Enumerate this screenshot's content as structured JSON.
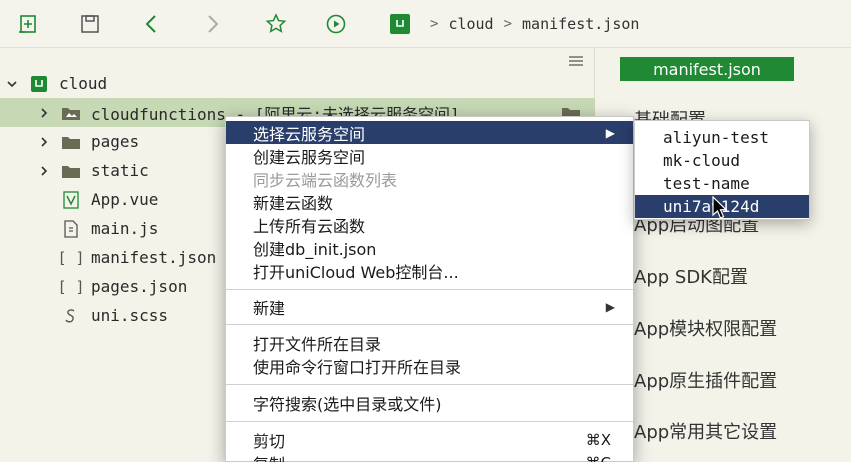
{
  "breadcrumb": {
    "project": "cloud",
    "file": "manifest.json"
  },
  "sidebar": {
    "items": [
      {
        "label": "cloud",
        "type": "project",
        "expanded": true,
        "level": 0
      },
      {
        "label": "cloudfunctions - [阿里云:未选择云服务空间]",
        "type": "folder",
        "level": 1,
        "selected": true
      },
      {
        "label": "pages",
        "type": "folder",
        "level": 1
      },
      {
        "label": "static",
        "type": "folder",
        "level": 1
      },
      {
        "label": "App.vue",
        "type": "vue",
        "level": 1
      },
      {
        "label": "main.js",
        "type": "js",
        "level": 1
      },
      {
        "label": "manifest.json",
        "type": "json",
        "level": 1
      },
      {
        "label": "pages.json",
        "type": "json",
        "level": 1
      },
      {
        "label": "uni.scss",
        "type": "scss",
        "level": 1
      }
    ]
  },
  "right_panel": {
    "tab": "manifest.json",
    "items": [
      "基础配置",
      "App启动图配置",
      "App  SDK配置",
      "App模块权限配置",
      "App原生插件配置",
      "App常用其它设置"
    ]
  },
  "context_menu": {
    "items": [
      {
        "label": "选择云服务空间",
        "submenu": true,
        "active": true
      },
      {
        "label": "创建云服务空间"
      },
      {
        "label": "同步云端云函数列表",
        "disabled": true
      },
      {
        "label": "新建云函数"
      },
      {
        "label": "上传所有云函数"
      },
      {
        "label": "创建db_init.json"
      },
      {
        "label": "打开uniCloud Web控制台..."
      },
      {
        "label": "新建",
        "submenu": true
      },
      {
        "label": "打开文件所在目录"
      },
      {
        "label": "使用命令行窗口打开所在目录"
      },
      {
        "label": "字符搜索(选中目录或文件)"
      },
      {
        "label": "剪切",
        "shortcut": "⌘X"
      },
      {
        "label": "复制",
        "shortcut": "⌘C"
      }
    ]
  },
  "submenu": {
    "items": [
      {
        "label": "aliyun-test"
      },
      {
        "label": "mk-cloud"
      },
      {
        "label": "test-name"
      },
      {
        "label": "uni7a9124d",
        "active": true
      }
    ]
  },
  "colors": {
    "accent_green": "#1f8a33",
    "selection_green": "#c6d9b4",
    "menu_highlight": "#2a3e6b",
    "folder": "#6b6b55"
  }
}
